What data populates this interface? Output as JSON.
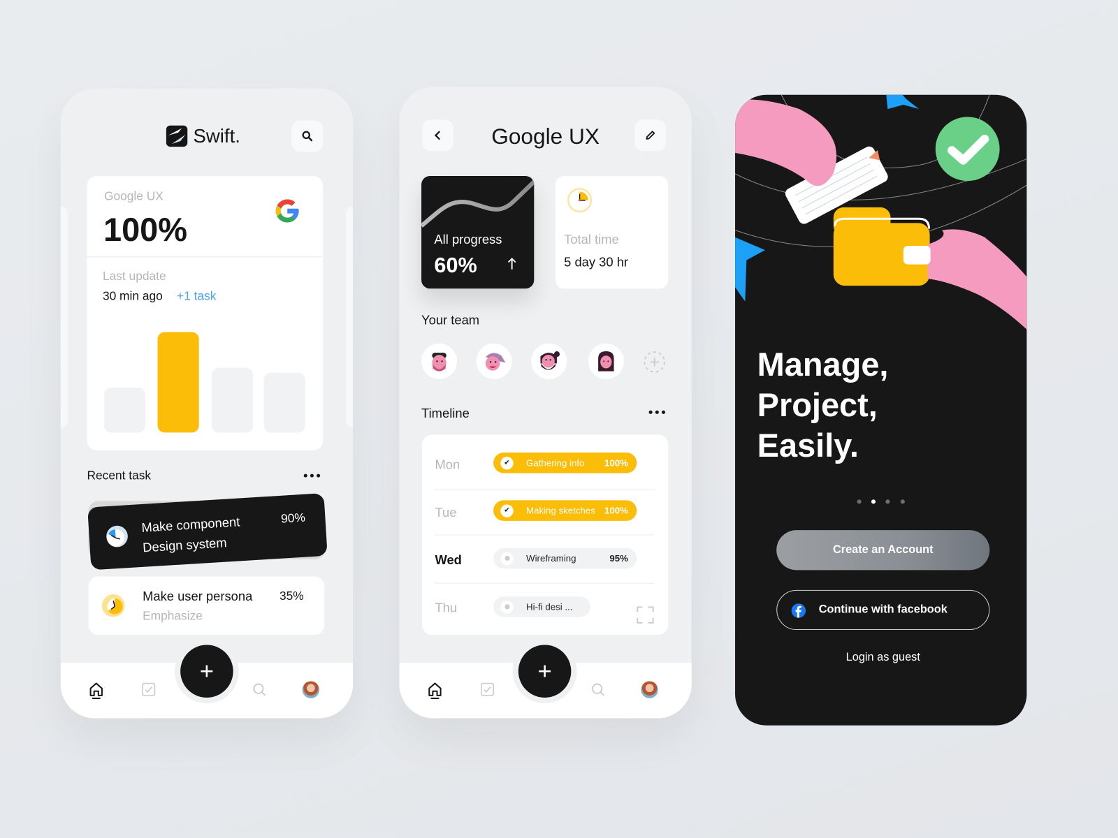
{
  "colors": {
    "accent_yellow": "#fbbd08",
    "dark": "#171717",
    "link_blue": "#4aa3f5",
    "success_green": "#6bd087",
    "star_blue": "#1da1f7",
    "hand_pink": "#f49bbf"
  },
  "screen1": {
    "brand": "Swift.",
    "icons": {
      "logo": "swift-logo-icon",
      "search": "search-icon",
      "google": "google-g-icon"
    },
    "project_card": {
      "name": "Google UX",
      "percent": "100%",
      "last_update_label": "Last update",
      "last_update_value": "30 min ago",
      "extra": "+1 task",
      "bars_relative_height": [
        0.45,
        1.0,
        0.65,
        0.6
      ],
      "highlighted_bar": 1
    },
    "recent_task": {
      "title": "Recent task",
      "tasks": [
        {
          "title": "Make component",
          "subtitle": "Design system",
          "percent": "90%",
          "progress": 0.9
        },
        {
          "title": "Make user persona",
          "subtitle": "Emphasize",
          "percent": "35%",
          "progress": 0.35
        }
      ]
    },
    "nav": {
      "items": [
        "home-icon",
        "tasks-check-icon",
        "add-button",
        "search-icon",
        "profile-avatar"
      ],
      "fab": "+",
      "active": "home"
    }
  },
  "screen2": {
    "title": "Google UX",
    "icons": {
      "back": "chevron-left-icon",
      "edit": "pencil-icon"
    },
    "progress_card": {
      "label": "All progress",
      "value": "60%",
      "trend": "up"
    },
    "time_card": {
      "label": "Total time",
      "value": "5 day 30 hr"
    },
    "team": {
      "title": "Your team",
      "member_count": 4
    },
    "timeline": {
      "title": "Timeline",
      "rows": [
        {
          "day": "Mon",
          "task": "Gathering info",
          "percent": "100%",
          "done": true
        },
        {
          "day": "Tue",
          "task": "Making sketches",
          "percent": "100%",
          "done": true
        },
        {
          "day": "Wed",
          "task": "Wireframing",
          "percent": "95%",
          "done": false,
          "current": true
        },
        {
          "day": "Thu",
          "task": "Hi-fi desi ...",
          "percent": "",
          "done": false
        }
      ]
    },
    "nav": {
      "fab": "+"
    }
  },
  "screen3": {
    "headline": [
      "Manage,",
      "Project,",
      "Easily."
    ],
    "pager": {
      "count": 4,
      "active": 1
    },
    "create_account": "Create an Account",
    "facebook": "Continue with facebook",
    "guest": "Login as guest"
  }
}
